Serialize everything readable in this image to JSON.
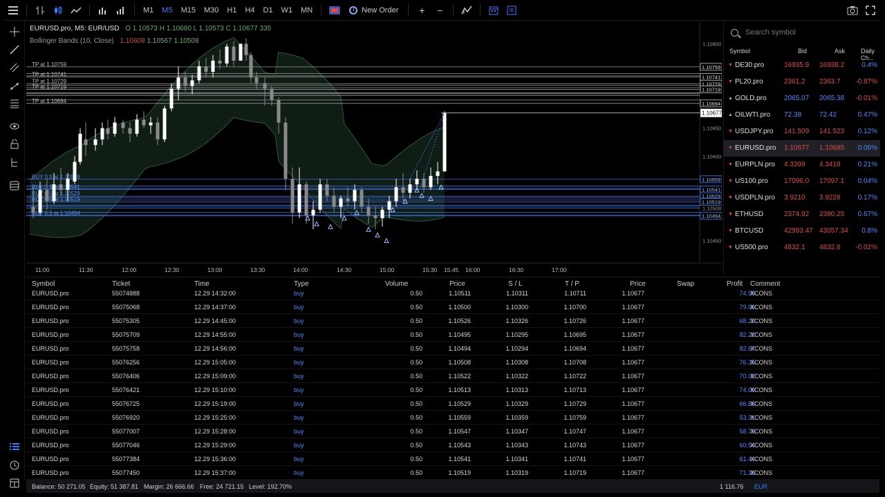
{
  "toolbar": {
    "timeframes": [
      "M1",
      "M5",
      "M15",
      "M30",
      "H1",
      "H4",
      "D1",
      "W1",
      "MN"
    ],
    "active_timeframe": "M5",
    "new_order": "New Order",
    "plus": "+",
    "minus": "−"
  },
  "chart": {
    "symbol_title": "EURUSD.pro, M5: EUR/USD",
    "ohlc": "O 1.10573 H 1.10680 L 1.10573 C 1.10677 335",
    "indicator_name": "Bollinger Bands (10, Close)",
    "indicator_values_1": "1.10608",
    "indicator_values_2": "1.10567 1.10508",
    "price_axis": [
      "1.10800",
      "1.10759",
      "1.10741",
      "1.10729",
      "1.10719",
      "1.10694",
      "1.10677",
      "1.10650",
      "1.10600",
      "1.10559",
      "1.10541",
      "1.10529",
      "1.10519",
      "1.10508",
      "1.10494",
      "1.10450"
    ],
    "time_axis": [
      "11:00",
      "11:30",
      "12:00",
      "12:30",
      "13:00",
      "13:30",
      "14:00",
      "14:30",
      "15:00",
      "15:30",
      "15:45",
      "16:00",
      "16:30",
      "17:00"
    ],
    "tp_labels": [
      "TP at 1.10759",
      "TP at 1.10741",
      "TP at 1.10729",
      "TP at 1.10719",
      "TP at 1.10694"
    ],
    "buy_labels": [
      "BUY 0.5 at 1.10559",
      "BUY 0.5 at 1.10541",
      "BUY 0.5 at 1.10529",
      "BUY 0.5 at 1.10519",
      "BUY 0.5 at 1.10494"
    ],
    "colors": {
      "up": "#ffffff",
      "down": "#8a8a8a",
      "tp": "#bfbfbf",
      "buy": "#3d7dff",
      "band": "#2e5a36"
    }
  },
  "watchlist": {
    "search_placeholder": "Search symbol",
    "headers": {
      "symbol": "Symbol",
      "bid": "Bid",
      "ask": "Ask",
      "daily": "Daily Ch..."
    },
    "rows": [
      {
        "symbol": "DE30.pro",
        "bid": "16935.9",
        "ask": "16938.2",
        "change": "0.4%",
        "dir": "down"
      },
      {
        "symbol": "PL20.pro",
        "bid": "2361.2",
        "ask": "2363.7",
        "change": "-0.87%",
        "dir": "down"
      },
      {
        "symbol": "GOLD.pro",
        "bid": "2065.07",
        "ask": "2065.38",
        "change": "-0.01%",
        "dir": "up"
      },
      {
        "symbol": "OILWTI.pro",
        "bid": "72.38",
        "ask": "72.42",
        "change": "0.47%",
        "dir": "up"
      },
      {
        "symbol": "USDJPY.pro",
        "bid": "141.509",
        "ask": "141.523",
        "change": "0.12%",
        "dir": "down"
      },
      {
        "symbol": "EURUSD.pro",
        "bid": "1.10677",
        "ask": "1.10685",
        "change": "0.06%",
        "dir": "down"
      },
      {
        "symbol": "EURPLN.pro",
        "bid": "4.3399",
        "ask": "4.3418",
        "change": "0.21%",
        "dir": "down"
      },
      {
        "symbol": "US100.pro",
        "bid": "17096.0",
        "ask": "17097.1",
        "change": "0.04%",
        "dir": "down"
      },
      {
        "symbol": "USDPLN.pro",
        "bid": "3.9210",
        "ask": "3.9228",
        "change": "0.17%",
        "dir": "down"
      },
      {
        "symbol": "ETHUSD",
        "bid": "2374.92",
        "ask": "2380.25",
        "change": "0.67%",
        "dir": "down"
      },
      {
        "symbol": "BTCUSD",
        "bid": "42993.47",
        "ask": "43057.34",
        "change": "0.8%",
        "dir": "down"
      },
      {
        "symbol": "US500.pro",
        "bid": "4832.1",
        "ask": "4832.8",
        "change": "-0.02%",
        "dir": "down"
      }
    ]
  },
  "positions": {
    "headers": [
      "Symbol",
      "Ticket",
      "Time",
      "Type",
      "Volume",
      "Price",
      "S / L",
      "T / P",
      "Price",
      "Swap",
      "Profit",
      "Comment"
    ],
    "rows": [
      [
        "EURUSD.pro",
        "55074888",
        "12.29 14:32:00",
        "buy",
        "0.50",
        "1.10511",
        "1.10311",
        "1.10711",
        "1.10677",
        "74.99",
        "XCONS"
      ],
      [
        "EURUSD.pro",
        "55075068",
        "12.29 14:37:00",
        "buy",
        "0.50",
        "1.10500",
        "1.10300",
        "1.10700",
        "1.10677",
        "79.96",
        "XCONS"
      ],
      [
        "EURUSD.pro",
        "55075305",
        "12.29 14:45:00",
        "buy",
        "0.50",
        "1.10526",
        "1.10326",
        "1.10726",
        "1.10677",
        "68.22",
        "XCONS"
      ],
      [
        "EURUSD.pro",
        "55075709",
        "12.29 14:55:00",
        "buy",
        "0.50",
        "1.10495",
        "1.10295",
        "1.10695",
        "1.10677",
        "82.22",
        "XCONS"
      ],
      [
        "EURUSD.pro",
        "55075758",
        "12.29 14:56:00",
        "buy",
        "0.50",
        "1.10494",
        "1.10294",
        "1.10694",
        "1.10677",
        "82.67",
        "XCONS"
      ],
      [
        "EURUSD.pro",
        "55076256",
        "12.29 15:05:00",
        "buy",
        "0.50",
        "1.10508",
        "1.10308",
        "1.10708",
        "1.10677",
        "76.35",
        "XCONS"
      ],
      [
        "EURUSD.pro",
        "55076406",
        "12.29 15:09:00",
        "buy",
        "0.50",
        "1.10522",
        "1.10322",
        "1.10722",
        "1.10677",
        "70.02",
        "XCONS"
      ],
      [
        "EURUSD.pro",
        "55076421",
        "12.29 15:10:00",
        "buy",
        "0.50",
        "1.10513",
        "1.10313",
        "1.10713",
        "1.10677",
        "74.09",
        "XCONS"
      ],
      [
        "EURUSD.pro",
        "55076725",
        "12.29 15:19:00",
        "buy",
        "0.50",
        "1.10529",
        "1.10329",
        "1.10729",
        "1.10677",
        "66.86",
        "XCONS"
      ],
      [
        "EURUSD.pro",
        "55076920",
        "12.29 15:25:00",
        "buy",
        "0.50",
        "1.10559",
        "1.10359",
        "1.10759",
        "1.10677",
        "53.31",
        "XCONS"
      ],
      [
        "EURUSD.pro",
        "55077007",
        "12.29 15:28:00",
        "buy",
        "0.50",
        "1.10547",
        "1.10347",
        "1.10747",
        "1.10677",
        "58.73",
        "XCONS"
      ],
      [
        "EURUSD.pro",
        "55077046",
        "12.29 15:29:00",
        "buy",
        "0.50",
        "1.10543",
        "1.10343",
        "1.10743",
        "1.10677",
        "60.54",
        "XCONS"
      ],
      [
        "EURUSD.pro",
        "55077384",
        "12.29 15:36:00",
        "buy",
        "0.50",
        "1.10541",
        "1.10341",
        "1.10741",
        "1.10677",
        "61.44",
        "XCONS"
      ],
      [
        "EURUSD.pro",
        "55077450",
        "12.29 15:37:00",
        "buy",
        "0.50",
        "1.10519",
        "1.10319",
        "1.10719",
        "1.10677",
        "71.38",
        "XCONS"
      ]
    ]
  },
  "status": {
    "balance": "Balance: 50 271.05",
    "equity": "Equity: 51 387.81",
    "margin": "Margin: 26 666.66",
    "free": "Free: 24 721.15",
    "level": "Level: 192.70%",
    "total_profit": "1 116.76",
    "currency": "EUR"
  }
}
